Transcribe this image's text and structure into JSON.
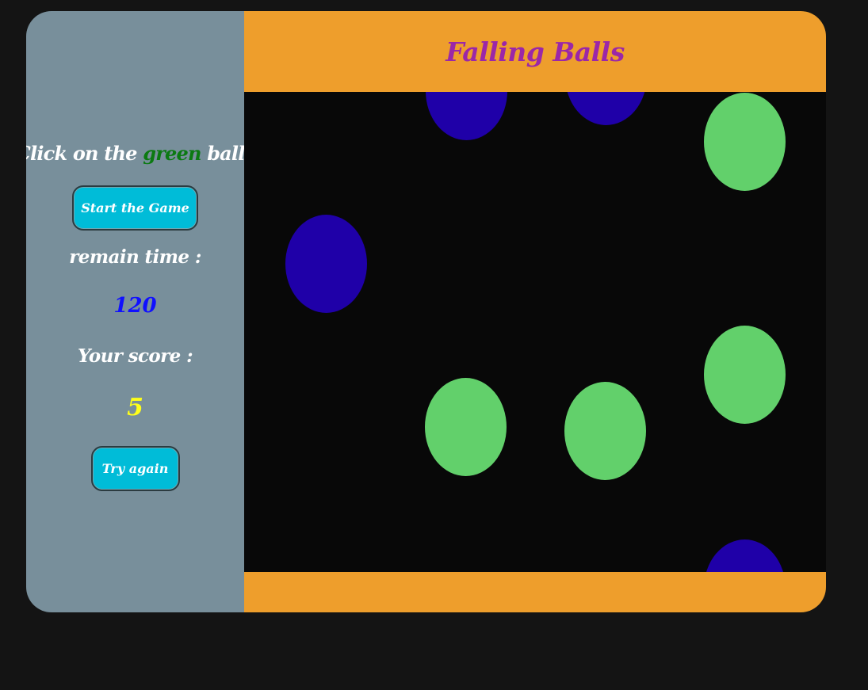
{
  "game": {
    "title": "Falling Balls"
  },
  "sidebar": {
    "instruction_prefix": "Click on the",
    "instruction_color_word": "green",
    "instruction_suffix": "balls",
    "start_button_label": "Start the Game",
    "remain_time_label": "remain time :",
    "remain_time_value": "120",
    "score_label": "Your score :",
    "score_value": "5",
    "try_again_label": "Try again"
  },
  "colors": {
    "background": "#141414",
    "sidebar": "#788f9b",
    "header_footer": "#ee9e2c",
    "title": "#9b27a8",
    "play_area": "#080808",
    "button": "#00bcd8",
    "green_ball": "#62d06b",
    "blue_ball": "#1f00a8",
    "time_value": "#1010ff",
    "score_value": "#ffff19",
    "instruction_green_word": "#0b7a11"
  },
  "balls": [
    {
      "color": "blue"
    },
    {
      "color": "blue"
    },
    {
      "color": "green"
    },
    {
      "color": "blue"
    },
    {
      "color": "green"
    },
    {
      "color": "green"
    },
    {
      "color": "green"
    },
    {
      "color": "blue"
    }
  ]
}
